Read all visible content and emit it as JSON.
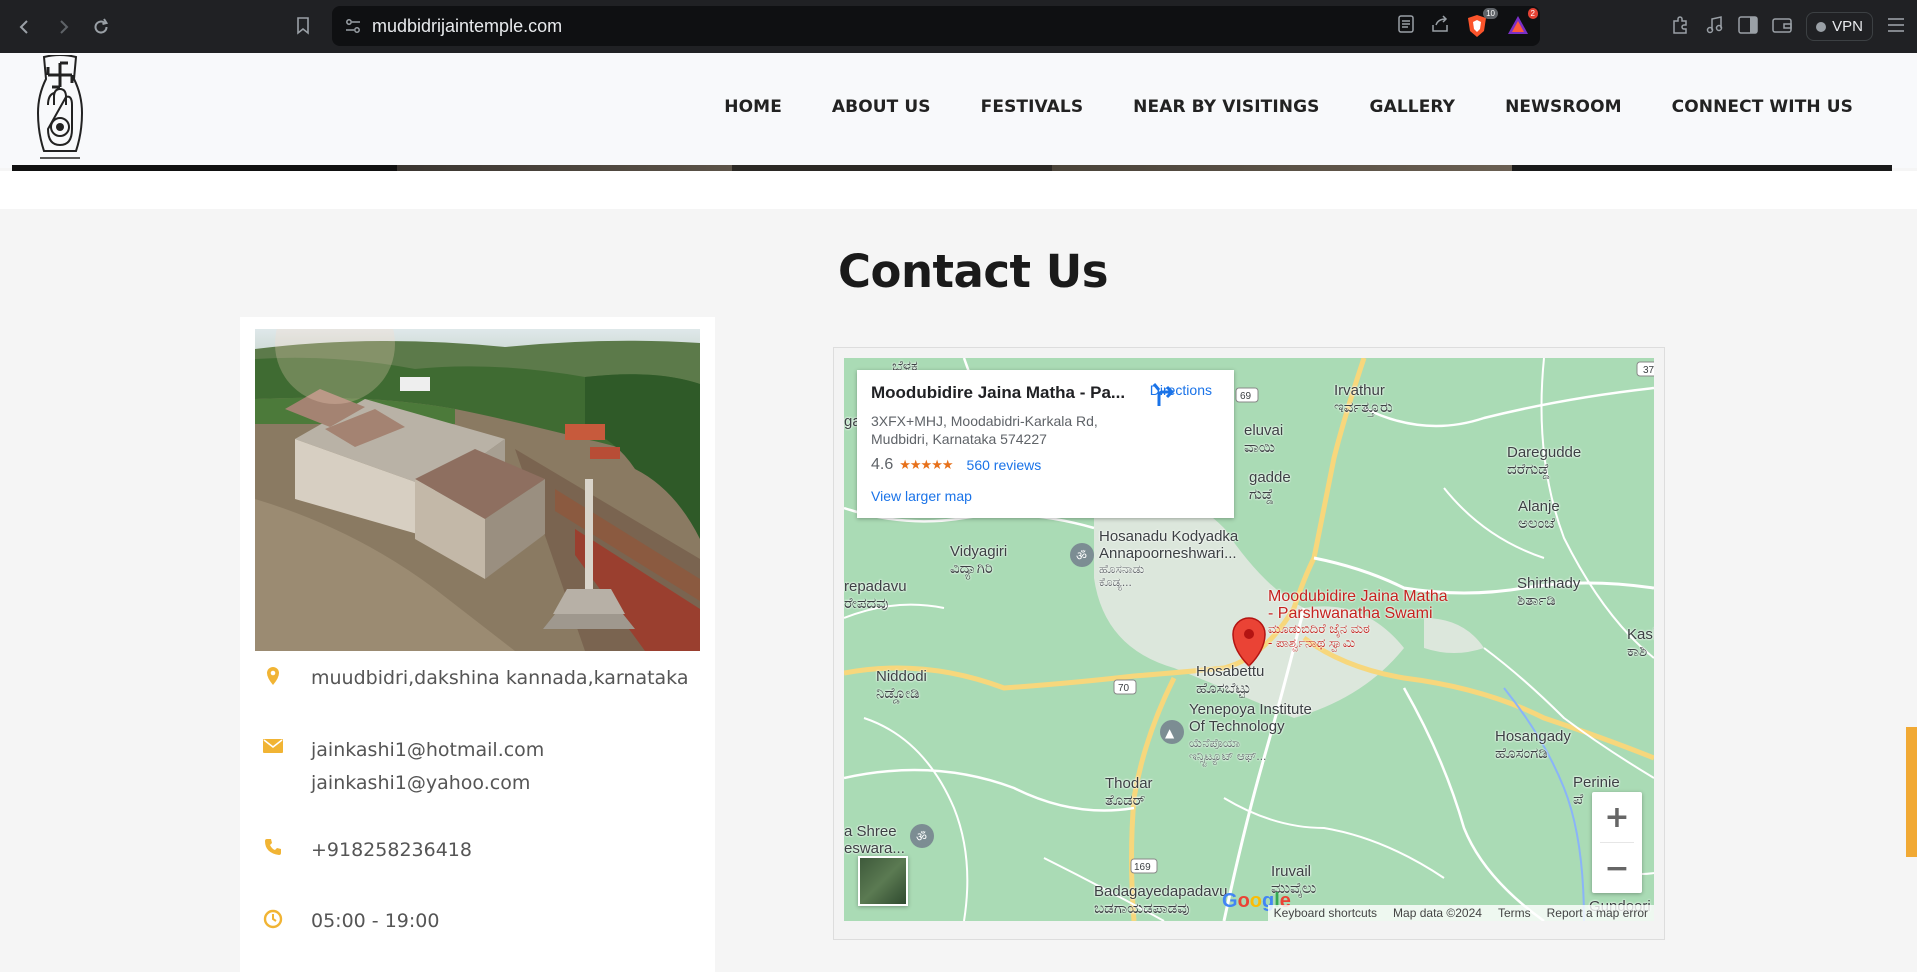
{
  "browser": {
    "url": "mudbidrijaintemple.com",
    "extension_badges": {
      "shields": "10",
      "rewards": "2"
    },
    "vpn_label": "VPN"
  },
  "site": {
    "menu": [
      "HOME",
      "ABOUT US",
      "FESTIVALS",
      "NEAR BY VISITINGS",
      "GALLERY",
      "NEWSROOM",
      "CONNECT WITH US"
    ]
  },
  "contact": {
    "title": "Contact Us",
    "address": "muudbidri,dakshina kannada,karnataka",
    "email_1": "jainkashi1@hotmail.com",
    "email_2": "jainkashi1@yahoo.com",
    "phone": "+918258236418",
    "hours": "05:00 - 19:00",
    "colors": {
      "icon_accent": "#f1b434"
    }
  },
  "map": {
    "place_name": "Moodubidire Jaina Matha - Pa...",
    "address_line1": "3XFX+MHJ, Moodabidri-Karkala Rd,",
    "address_line2": "Mudbidri, Karnataka 574227",
    "rating": "4.6",
    "reviews": "560 reviews",
    "directions": "Directions",
    "larger_map": "View larger map",
    "marker_label_1": "Moodubidire Jaina Matha",
    "marker_label_2": "- Parshwanatha Swami",
    "marker_label_kn_1": "ಮೂಡುಬಿದಿರೆ ಜೈನ ಮಠ",
    "marker_label_kn_2": "- ಪಾರ್ಶ್ವನಾಥ ಸ್ವಾಮಿ",
    "labels": {
      "irvathur": "Irvathur",
      "irvathur_kn": "ಇರ್ವತ್ತೂರು",
      "dAregudde": "Daregudde",
      "dAregudde_kn": "ದರೆಗುಡ್ಡೆ",
      "alanje": "Alanje",
      "alanje_kn": "ಅಲಂಜೆ",
      "shirthady": "Shirthady",
      "shirthady_kn": "ಶಿರ್ತಾಡಿ",
      "kashi": "Kashi",
      "kashi_kn": "ಕಾಶಿ",
      "vidyagiri": "Vidyagiri",
      "vidyagiri_kn": "ವಿದ್ಯಾಗಿರಿ",
      "hosanadu": "Hosanadu Kodyadka",
      "hosanadu_2": "Annapoorneshwari...",
      "hosanadu_kn": "ಹೊಸನಾಡು",
      "hosanadu_kn2": "ಕೊಡ್ಯ...",
      "repadavu": "repadavu",
      "repadavu_kn": "ರೇಪದವು",
      "niddodi": "Niddodi",
      "niddodi_kn": "ನಿಡ್ಡೋಡಿ",
      "hosabettu": "Hosabettu",
      "hosabettu_kn": "ಹೊಸಬೆಟ್ಟು",
      "yenepoya_1": "Yenepoya Institute",
      "yenepoya_2": "Of Technology",
      "yenepoya_kn1": "ಯೆನೆಪೊಯಾ",
      "yenepoya_kn2": "ಇನ್ಸ್ಟಿಟ್ಯೂಟ್ ಆಫ್...",
      "hosangady": "Hosangady",
      "hosangady_kn": "ಹೊಸಂಗಡಿ",
      "perinie": "Perinie",
      "perinie_kn": "ಪೆ",
      "thodar": "Thodar",
      "thodar_kn": "ತೊಡರ್",
      "shree_1": "a Shree",
      "shree_2": "eswara...",
      "iruvail": "Iruvail",
      "iruvail_kn": "ಮುವೈಲು",
      "badagayedapadavu": "Badagayedapadavu",
      "badagayedapadavu_kn": "ಬಡಗಾಯಡಪಾಡವು",
      "gundoori": "Gundoori",
      "beluvai": "eluvai",
      "beluvai_kn": "ವಾಯಿ",
      "gadde": "gadde",
      "gadde_kn": "ಗುಡ್ಡೆ",
      "top_kn": "ಬೆಳಕ",
      "ga": "ga",
      "road_37": "37",
      "road_169": "169",
      "road_69": "69",
      "road_70": "70",
      "road_169b": "169"
    },
    "attribution": [
      "Keyboard shortcuts",
      "Map data ©2024",
      "Terms",
      "Report a map error"
    ],
    "google": "Google",
    "zoom_in": "+",
    "zoom_out": "−"
  }
}
